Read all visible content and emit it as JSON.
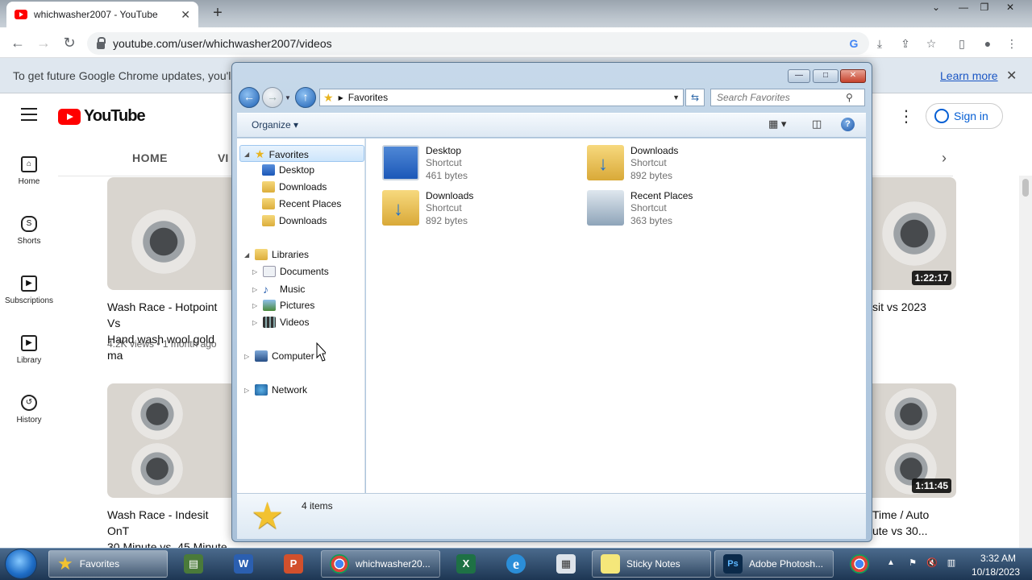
{
  "browser": {
    "tab_title": "whichwasher2007 - YouTube",
    "tab_close": "✕",
    "new_tab": "+",
    "url": "youtube.com/user/whichwasher2007/videos",
    "window_controls": [
      "—",
      "❐",
      "✕"
    ],
    "tab_menu": "⌄"
  },
  "infobar": {
    "text": "To get future Google Chrome updates, you'll ne",
    "learn_more": "Learn more",
    "close": "✕"
  },
  "youtube": {
    "logo": "YouTube",
    "sign_in": "Sign in",
    "kebab": "⋮",
    "tabs": {
      "home": "HOME",
      "videos_partial": "VI",
      "next": "›"
    },
    "sidebar": [
      {
        "label": "Home",
        "icon": "home-icon",
        "glyph": "⌂"
      },
      {
        "label": "Shorts",
        "icon": "shorts-icon",
        "glyph": "S"
      },
      {
        "label": "Subscriptions",
        "icon": "subscriptions-icon",
        "glyph": "▶"
      },
      {
        "label": "Library",
        "icon": "library-icon",
        "glyph": "▶"
      },
      {
        "label": "History",
        "icon": "history-icon",
        "glyph": "↺"
      }
    ],
    "videos": [
      {
        "title_line1": "Wash Race - Hotpoint Vs",
        "title_line2": "Hand wash wool gold ma",
        "meta": "4.2K views • 1 month ago"
      },
      {
        "duration": "1:22:17",
        "title_line1": "sit vs 2023"
      },
      {
        "title_line1": "Wash Race - Indesit OnT",
        "title_line2": "30 Minute vs. 45 Minute"
      },
      {
        "duration": "1:11:45",
        "title_line1": "Time / Auto",
        "title_line2": "ute vs 30..."
      }
    ]
  },
  "explorer": {
    "caption_buttons": [
      "—",
      "□",
      "✕"
    ],
    "address": "Favorites",
    "search_placeholder": "Search Favorites",
    "organize": "Organize ▾",
    "help": "?",
    "nav_tree": {
      "favorites": "Favorites",
      "favorites_items": [
        "Desktop",
        "Downloads",
        "Recent Places",
        "Downloads"
      ],
      "libraries": "Libraries",
      "libraries_items": [
        "Documents",
        "Music",
        "Pictures",
        "Videos"
      ],
      "computer": "Computer",
      "network": "Network"
    },
    "items": [
      {
        "name": "Desktop",
        "type": "Shortcut",
        "size": "461 bytes",
        "icon": "desktop-icon"
      },
      {
        "name": "Downloads",
        "type": "Shortcut",
        "size": "892 bytes",
        "icon": "downloads-folder-icon"
      },
      {
        "name": "Downloads",
        "type": "Shortcut",
        "size": "892 bytes",
        "icon": "downloads-folder-icon"
      },
      {
        "name": "Recent Places",
        "type": "Shortcut",
        "size": "363 bytes",
        "icon": "recent-places-icon"
      }
    ],
    "item_count": "4 items"
  },
  "taskbar": {
    "buttons": [
      {
        "label": "Favorites",
        "icon": "star-icon",
        "active": true
      },
      {
        "label": "whichwasher20...",
        "icon": "chrome-icon"
      },
      {
        "label": "Sticky Notes",
        "icon": "sticky-notes-icon"
      },
      {
        "label": "Adobe Photosh...",
        "icon": "photoshop-icon"
      }
    ],
    "pinned": [
      {
        "icon": "task-manager-icon",
        "glyph": "▤"
      },
      {
        "icon": "word-icon",
        "glyph": "W"
      },
      {
        "icon": "powerpoint-icon",
        "glyph": "P"
      },
      {
        "icon": "excel-icon",
        "glyph": "X"
      },
      {
        "icon": "internet-explorer-icon",
        "glyph": "e"
      },
      {
        "icon": "calculator-icon",
        "glyph": "▦"
      },
      {
        "icon": "chrome-icon",
        "glyph": "◉"
      }
    ],
    "clock_time": "3:32 AM",
    "clock_date": "10/18/2023"
  },
  "colors": {
    "youtube_red": "#ff0000",
    "link_blue": "#065fd4",
    "explorer_frame": "#b7cde3",
    "taskbar": "#1d3653"
  }
}
